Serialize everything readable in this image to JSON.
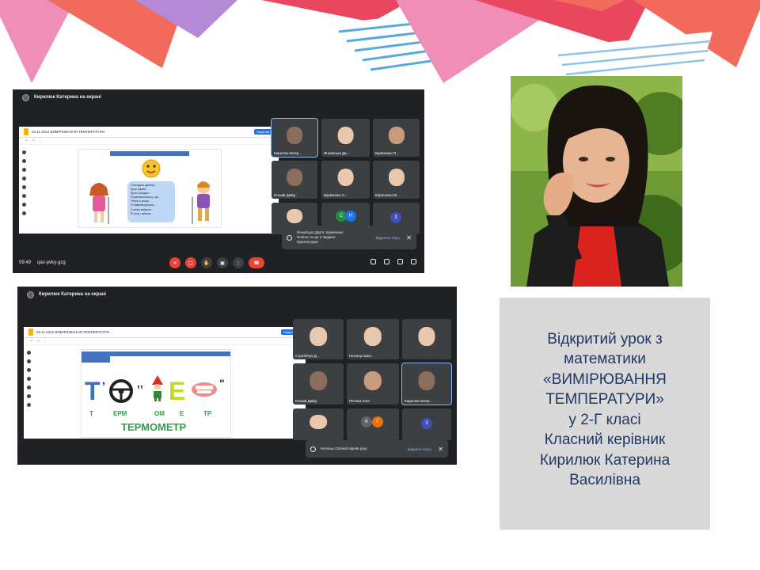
{
  "colors": {
    "bunting_pink": "#ef8fb8",
    "bunting_red": "#e8475d",
    "bunting_salmon": "#f26a5c",
    "bunting_blue": "#5aa8e0",
    "bunting_purple": "#b48ad6",
    "caption_bg": "#d9d9d9",
    "caption_text": "#1f3864",
    "meet_bg": "#202124"
  },
  "screenshot1": {
    "presenter": "Кирилюк Катерина на екрані",
    "doc_title": "03.11.2022 ВИМІРЮВАННЯ ТЕМПЕРАТУРИ",
    "share_label": "Надіслати",
    "speech_lines": [
      "Сьогодні в ділянці...",
      "було цікаво...",
      "було холодно...",
      "Я дізнався(лась), що...",
      "Тепер я можу...",
      "Я навчився(лася)...",
      "У мене вийшло...",
      "Я хочу / змогла..."
    ],
    "tiles": [
      {
        "name": "Кирилюк Катер..."
      },
      {
        "name": "Янковська Да..."
      },
      {
        "name": "Кравченко П..."
      },
      {
        "name": "Юзьків Давід"
      },
      {
        "name": "Кравченко Л..."
      },
      {
        "name": "Кириченко Ві..."
      }
    ],
    "toast_text_1": "Янковська Дар'я, Кравченко",
    "toast_text_2": "Поліна та ще 3 людини",
    "toast_text_3": "підняли руки",
    "toast_action": "Відкрити чергу",
    "clock": "09:49",
    "meeting_code": "qav-pvky-gzg",
    "avatar_letters": [
      "С",
      "Н"
    ],
    "avatar_count": "3"
  },
  "screenshot2": {
    "presenter": "Кирилюк Катерина на екрані",
    "doc_title": "03.11.2022 ВИМІРЮВАННЯ ТЕМПЕРАТУРИ",
    "share_label": "Надіслати",
    "rebus_syllables": [
      "Т",
      "ЕРМ",
      "ОМ",
      "Е",
      "ТР"
    ],
    "rebus_answer": "ТЕРМОМЕТР",
    "tiles": [
      {
        "name": "Стратійчук Д..."
      },
      {
        "name": "Негаєць Євге..."
      },
      {
        "name": ""
      },
      {
        "name": "Юзьків Давід"
      },
      {
        "name": "Петлюк Ілля"
      },
      {
        "name": "Кирилюк Катер..."
      }
    ],
    "toast_text": "Негаєць Євгеній підняв руку",
    "toast_action": "Відкрити чергу",
    "avatar_letters": [
      "К",
      "Г"
    ],
    "avatar_count": "3"
  },
  "caption": {
    "lines": [
      "Відкритий урок з",
      "математики",
      "«ВИМІРЮВАННЯ",
      "ТЕМПЕРАТУРИ»",
      "у 2-Г класі",
      "Класний керівник",
      "Кирилюк Катерина",
      "Василівна"
    ]
  }
}
